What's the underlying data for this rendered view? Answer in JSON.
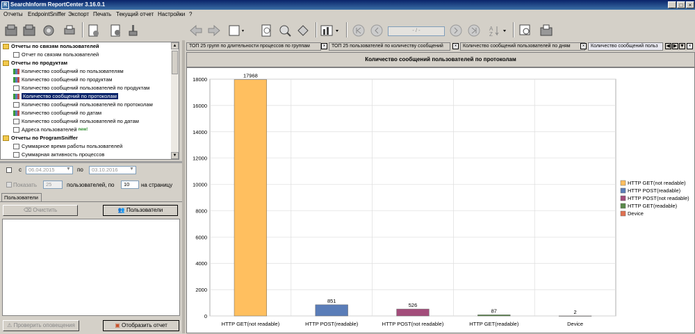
{
  "window": {
    "title": "SearchInform ReportCenter 3.16.0.1",
    "app_icon": "R"
  },
  "menu": [
    "Отчеты",
    "EndpointSniffer",
    "Экспорт",
    "Печать",
    "Текущий отчет",
    "Настройки",
    "?"
  ],
  "tree": [
    {
      "label": "Отчеты по связям пользователей",
      "type": "group"
    },
    {
      "label": "Отчет по связям пользователей",
      "type": "item",
      "icon": "people-icon"
    },
    {
      "label": "Отчеты по продуктам",
      "type": "group"
    },
    {
      "label": "Количество сообщений по пользователям",
      "type": "item",
      "icon": "chart-icon"
    },
    {
      "label": "Количество сообщений по продуктам",
      "type": "item",
      "icon": "chart-icon"
    },
    {
      "label": "Количество сообщений пользователей по продуктам",
      "type": "item",
      "icon": "doc-icon"
    },
    {
      "label": "Количество сообщений по протоколам",
      "type": "item",
      "icon": "chart-icon",
      "selected": true
    },
    {
      "label": "Количество сообщений пользователей по протоколам",
      "type": "item",
      "icon": "doc-icon"
    },
    {
      "label": "Количество сообщений по датам",
      "type": "item",
      "icon": "chart-icon"
    },
    {
      "label": "Количество сообщений пользователей по датам",
      "type": "item",
      "icon": "doc-icon"
    },
    {
      "label": "Адреса пользователей",
      "type": "item",
      "icon": "people-icon",
      "badge": "new!"
    },
    {
      "label": "Отчеты по ProgramSniffer",
      "type": "group"
    },
    {
      "label": "Суммарное время работы пользователей",
      "type": "item",
      "icon": "people-icon"
    },
    {
      "label": "Суммарная активность процессов",
      "type": "item",
      "icon": "people-icon"
    }
  ],
  "filters": {
    "from_label": "с",
    "from_date": "06.04.2015",
    "to_label": "по",
    "to_date": "03.10.2016",
    "show_label": "Показать",
    "show_count": "25",
    "users_label": "пользователей, по",
    "per_page": "10",
    "per_page_label": "на страницу"
  },
  "users_panel": {
    "tab": "Пользователи",
    "clear_button": "Очистить",
    "users_button": "Пользователи"
  },
  "bottom_buttons": {
    "check_alerts": "Проверить оповещения",
    "show_report": "Отобразить отчет"
  },
  "toolbar": {
    "page_field": "- / -"
  },
  "report_tabs": [
    {
      "label": "ТОП 25 групп по длительности процессов по группам"
    },
    {
      "label": "ТОП 25 пользователей по количеству сообщений"
    },
    {
      "label": "Количество сообщений пользователей по дням"
    },
    {
      "label": "Количество сообщений польз",
      "active": true
    }
  ],
  "chart_data": {
    "type": "bar",
    "title": "Количество сообщений пользователей по протоколам",
    "categories": [
      "HTTP GET(not readable)",
      "HTTP POST(readable)",
      "HTTP POST(not readable)",
      "HTTP GET(readable)",
      "Device"
    ],
    "values": [
      17968,
      851,
      526,
      87,
      2
    ],
    "colors": [
      "#ffbf5f",
      "#5a7db8",
      "#a34d7b",
      "#5a8a4a",
      "#e07050"
    ],
    "ylim": [
      0,
      18000
    ],
    "yticks": [
      0,
      2000,
      4000,
      6000,
      8000,
      10000,
      12000,
      14000,
      16000,
      18000
    ],
    "grid": true,
    "legend_position": "right",
    "legend": [
      "HTTP GET(not readable)",
      "HTTP POST(readable)",
      "HTTP POST(not readable)",
      "HTTP GET(readable)",
      "Device"
    ]
  }
}
